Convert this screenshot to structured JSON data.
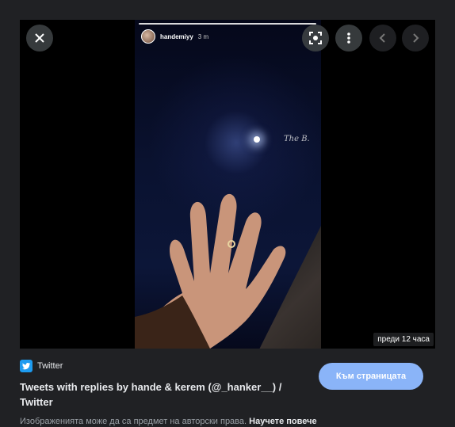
{
  "story": {
    "username": "handemiyy",
    "time": "3 m",
    "watermark": "The B."
  },
  "controls": {
    "close_icon": "close-icon",
    "lens_icon": "lens-icon",
    "more_icon": "more-vert-icon",
    "prev_icon": "chevron-left-icon",
    "next_icon": "chevron-right-icon"
  },
  "viewer": {
    "timestamp_badge": "преди 12 часа"
  },
  "source": {
    "name": "Twitter",
    "icon": "twitter-icon",
    "title": "Tweets with replies by hande & kerem (@_hanker__) / Twitter"
  },
  "visit_button": "Към страницата",
  "copyright": {
    "text": "Изображенията може да са предмет на авторски права.",
    "link": "Научете повече"
  },
  "colors": {
    "background": "#202124",
    "accent": "#8ab4f8",
    "twitter": "#1d9bf0"
  }
}
